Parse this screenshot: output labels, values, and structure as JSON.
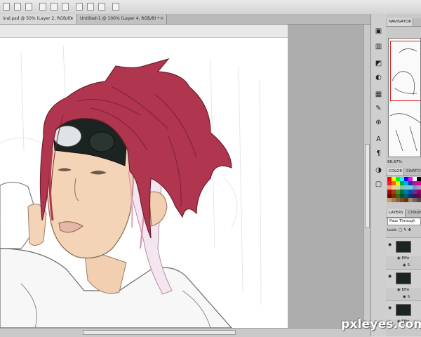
{
  "tabs": [
    {
      "label": "inal.psd @ 50% (Layer 2, RGB/8)",
      "close": "×"
    },
    {
      "label": "Untitled-1 @ 100% (Layer 4, RGB/8) *",
      "close": "×"
    }
  ],
  "toolstrip_icons": [
    "navigator-panel-icon",
    "histogram-icon",
    "info-icon",
    "color-icon",
    "swatches-icon",
    "brushes-icon",
    "clone-source-icon",
    "character-icon",
    "paragraph-icon",
    "masks-icon",
    "adjustments-icon"
  ],
  "navigator": {
    "tab": "NAVIGATOR",
    "zoom": "66.67%"
  },
  "color": {
    "tabs": [
      "COLOR",
      "SWATCH"
    ]
  },
  "layers": {
    "tabs": [
      "LAYERS",
      "CHANN"
    ],
    "blend_mode": "Pass Through",
    "lock_label": "Lock:",
    "effects_label": "Effe",
    "sub_label": "S"
  },
  "colors": {
    "hair": "#b0354e",
    "skin": "#f4d4b6",
    "goggles": "#1b2421",
    "canvas": "#ffffff"
  },
  "watermark": "pxleyes.com"
}
